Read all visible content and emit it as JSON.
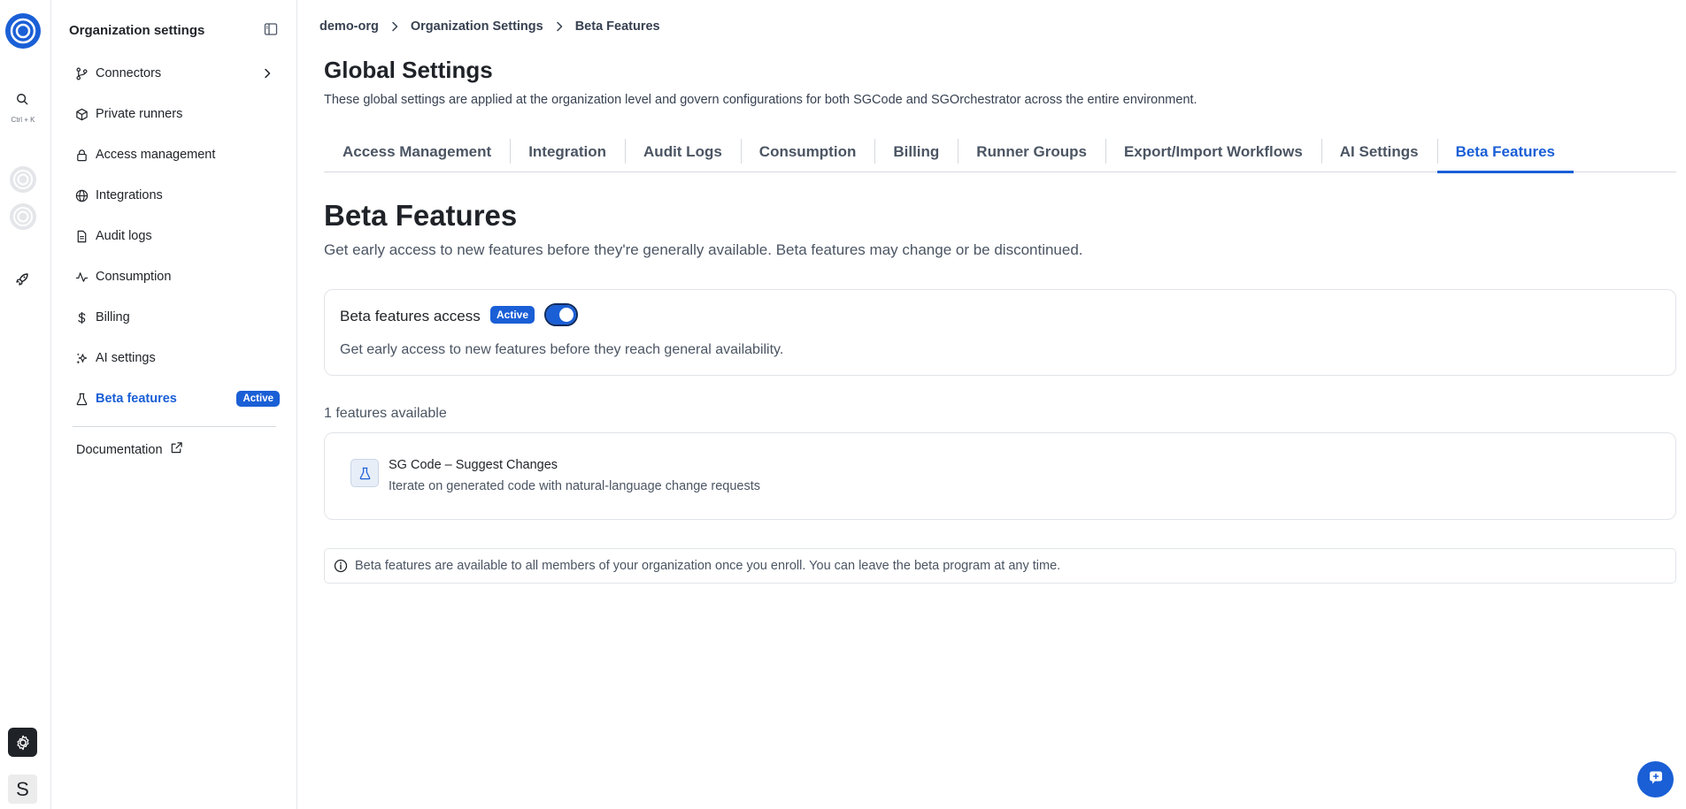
{
  "rail": {
    "shortcut": "Ctrl + K",
    "avatar_letter": "S"
  },
  "sidebar": {
    "title": "Organization settings",
    "items": [
      {
        "label": "Connectors",
        "icon": "branch-icon"
      },
      {
        "label": "Private runners",
        "icon": "cube-icon"
      },
      {
        "label": "Access management",
        "icon": "lock-icon"
      },
      {
        "label": "Integrations",
        "icon": "globe-icon"
      },
      {
        "label": "Audit logs",
        "icon": "file-icon"
      },
      {
        "label": "Consumption",
        "icon": "activity-icon"
      },
      {
        "label": "Billing",
        "icon": "dollar-icon"
      },
      {
        "label": "AI settings",
        "icon": "sparkle-icon"
      },
      {
        "label": "Beta features",
        "icon": "flask-icon",
        "badge": "Active"
      }
    ],
    "documentation_label": "Documentation"
  },
  "breadcrumb": [
    "demo-org",
    "Organization Settings",
    "Beta Features"
  ],
  "header": {
    "title": "Global Settings",
    "subtitle": "These global settings are applied at the organization level and govern configurations for both SGCode and SGOrchestrator across the entire environment."
  },
  "tabs": [
    "Access Management",
    "Integration",
    "Audit Logs",
    "Consumption",
    "Billing",
    "Runner Groups",
    "Export/Import Workflows",
    "AI Settings",
    "Beta Features"
  ],
  "section": {
    "title": "Beta Features",
    "subtitle": "Get early access to new features before they're generally available. Beta features may change or be discontinued."
  },
  "access_card": {
    "title": "Beta features access",
    "badge": "Active",
    "enabled": true,
    "description": "Get early access to new features before they reach general availability."
  },
  "features": {
    "count_label": "1 features available",
    "items": [
      {
        "name": "SG Code – Suggest Changes",
        "description": "Iterate on generated code with natural-language change requests"
      }
    ]
  },
  "note": "Beta features are available to all members of your organization once you enroll. You can leave the beta program at any time.",
  "colors": {
    "accent": "#1a5fd6",
    "text": "#1f2328",
    "muted": "#4b5563",
    "border": "#e1e4e8"
  }
}
